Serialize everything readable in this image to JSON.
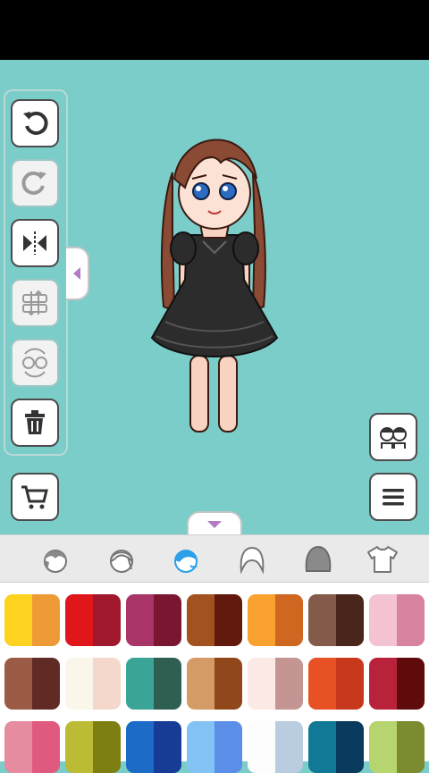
{
  "app": {
    "background": "#7bcdc9"
  },
  "toolbar": {
    "items": [
      {
        "name": "undo",
        "icon": "undo-icon",
        "enabled": true
      },
      {
        "name": "redo",
        "icon": "redo-icon",
        "enabled": false
      },
      {
        "name": "flip",
        "icon": "flip-horizontal-icon",
        "enabled": true
      },
      {
        "name": "layer-order",
        "icon": "layer-order-icon",
        "enabled": false
      },
      {
        "name": "swap-character",
        "icon": "swap-character-icon",
        "enabled": false
      },
      {
        "name": "delete",
        "icon": "trash-icon",
        "enabled": true
      }
    ]
  },
  "categories": [
    {
      "name": "hair-front",
      "icon": "hair-front-icon",
      "active": false
    },
    {
      "name": "hair-side",
      "icon": "hair-side-icon",
      "active": false
    },
    {
      "name": "hair-back",
      "icon": "hair-back-icon",
      "active": true
    },
    {
      "name": "head-shape",
      "icon": "head-shape-icon",
      "active": false
    },
    {
      "name": "hair-color",
      "icon": "hair-color-icon",
      "active": false
    },
    {
      "name": "clothing",
      "icon": "shirt-icon",
      "active": false
    }
  ],
  "palette": {
    "rows": [
      [
        [
          "#fdd31f",
          "#ee9a36"
        ],
        [
          "#e0161a",
          "#a0182b"
        ],
        [
          "#a93568",
          "#7a1632"
        ],
        [
          "#a2521e",
          "#62190d"
        ],
        [
          "#f9a22f",
          "#cf6720"
        ],
        [
          "#845a4b",
          "#4a251b"
        ],
        [
          "#f4c3d2",
          "#d7839f"
        ]
      ],
      [
        [
          "#9c5b45",
          "#602b25"
        ],
        [
          "#fbf6ea",
          "#f3d8cb"
        ],
        [
          "#3aa596",
          "#2f5e52"
        ],
        [
          "#d49b66",
          "#90471c"
        ],
        [
          "#fbe9e6",
          "#c59594"
        ],
        [
          "#e85124",
          "#c7381d"
        ],
        [
          "#b8223a",
          "#5f0b0b"
        ]
      ],
      [
        [
          "#e58ca0",
          "#df5a7e"
        ],
        [
          "#bcbb35",
          "#7d7f13"
        ],
        [
          "#1c6bc6",
          "#163c95"
        ],
        [
          "#82c2f4",
          "#5b8ee7"
        ],
        [
          "#fdfdfd",
          "#bacde0"
        ],
        [
          "#117896",
          "#0a3b5e"
        ],
        [
          "#b7d56f",
          "#7b8b30"
        ]
      ]
    ]
  }
}
